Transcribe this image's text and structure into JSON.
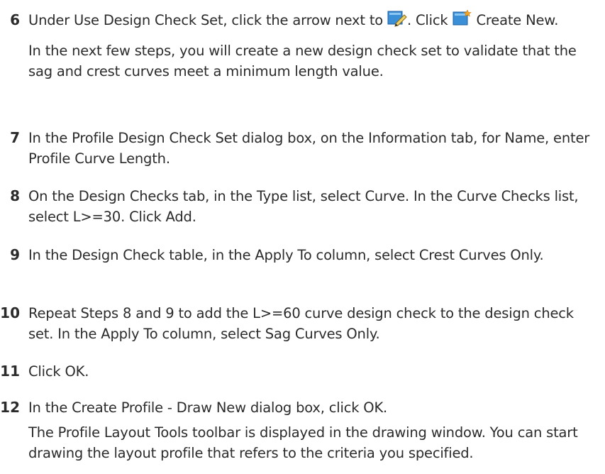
{
  "steps": [
    {
      "number": "6",
      "text_a": "Under Use Design Check Set, click the arrow next to ",
      "icon1": "edit-design-check-set-icon",
      "text_b": ". Click ",
      "icon2": "create-new-icon",
      "text_c": " Create New.",
      "note": "In the next few steps, you will create a new design check set to validate that the sag and crest curves meet a minimum length value."
    },
    {
      "number": "7",
      "text": "In the Profile Design Check Set dialog box, on the Information tab, for Name, enter Profile Curve Length."
    },
    {
      "number": "8",
      "text": "On the Design Checks tab, in the Type list, select Curve. In the Curve Checks list, select L>=30. Click Add."
    },
    {
      "number": "9",
      "text": "In the Design Check table, in the Apply To column, select Crest Curves Only."
    },
    {
      "number": "10",
      "text": "Repeat Steps 8 and 9 to add the L>=60 curve design check to the design check set. In the Apply To column, select Sag Curves Only."
    },
    {
      "number": "11",
      "text": "Click OK."
    },
    {
      "number": "12",
      "text": "In the Create Profile - Draw New dialog box, click OK.",
      "note": "The Profile Layout Tools toolbar is displayed in the drawing window. You can start drawing the layout profile that refers to the criteria you specified."
    }
  ]
}
